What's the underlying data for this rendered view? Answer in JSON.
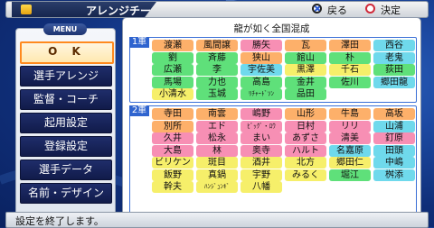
{
  "header": {
    "title": "アレンジチーム",
    "back_label": "戻る",
    "confirm_label": "決定"
  },
  "menu": {
    "heading": "MENU",
    "items": [
      {
        "label": "O K"
      },
      {
        "label": "選手アレンジ"
      },
      {
        "label": "監督・コーチ"
      },
      {
        "label": "起用設定"
      },
      {
        "label": "登録設定"
      },
      {
        "label": "選手データ"
      },
      {
        "label": "名前・デザイン"
      }
    ]
  },
  "roster": {
    "title": "龍が如く全国混成",
    "colors": {
      "orange": "#fdb06a",
      "pink": "#f78fb4",
      "green": "#5fe07a",
      "yellow": "#f6ef6a",
      "cyan": "#6fd9ec",
      "accent_blue": "#2f64cf"
    },
    "first_team": {
      "label": "1軍",
      "players": [
        [
          "渡瀬",
          "orange"
        ],
        [
          "風間譲",
          "orange"
        ],
        [
          "勝矢",
          "pink"
        ],
        [
          "瓦",
          "orange"
        ],
        [
          "澤田",
          "orange"
        ],
        [
          "西谷",
          "cyan"
        ],
        [
          "劉",
          "green"
        ],
        [
          "斉藤",
          "green"
        ],
        [
          "狭山",
          "orange"
        ],
        [
          "館山",
          "green"
        ],
        [
          "朴",
          "green"
        ],
        [
          "老鬼",
          "cyan"
        ],
        [
          "広瀬",
          "green"
        ],
        [
          "李",
          "green"
        ],
        [
          "宇佐美",
          "cyan"
        ],
        [
          "黒澤",
          "yellow"
        ],
        [
          "千石",
          "yellow"
        ],
        [
          "荻田",
          "green"
        ],
        [
          "馬場",
          "green"
        ],
        [
          "力也",
          "green"
        ],
        [
          "高島",
          "green"
        ],
        [
          "金井",
          "green"
        ],
        [
          "佐川",
          "green"
        ],
        [
          "郷田龍",
          "cyan"
        ],
        [
          "小清水",
          "yellow"
        ],
        [
          "玉城",
          "green"
        ],
        [
          "ﾘﾁｬｰﾄﾞｿﾝ",
          "green"
        ],
        [
          "品田",
          "green"
        ]
      ]
    },
    "second_team": {
      "label": "2軍",
      "players": [
        [
          "寺田",
          "orange"
        ],
        [
          "南雲",
          "orange"
        ],
        [
          "嶋野",
          "pink"
        ],
        [
          "山形",
          "orange"
        ],
        [
          "牛島",
          "orange"
        ],
        [
          "高坂",
          "orange"
        ],
        [
          "別所",
          "orange"
        ],
        [
          "エド",
          "pink"
        ],
        [
          "ﾋﾞｯｸﾞ・ﾛｳ",
          "pink"
        ],
        [
          "日村",
          "pink"
        ],
        [
          "リリ",
          "pink"
        ],
        [
          "山浦",
          "cyan"
        ],
        [
          "久井",
          "pink"
        ],
        [
          "松永",
          "pink"
        ],
        [
          "まい",
          "pink"
        ],
        [
          "あずさ",
          "pink"
        ],
        [
          "清美",
          "pink"
        ],
        [
          "釘原",
          "pink"
        ],
        [
          "大島",
          "pink"
        ],
        [
          "林",
          "pink"
        ],
        [
          "奥寺",
          "pink"
        ],
        [
          "ハルト",
          "pink"
        ],
        [
          "名嘉原",
          "cyan"
        ],
        [
          "田頭",
          "cyan"
        ],
        [
          "ビリケン",
          "yellow"
        ],
        [
          "斑目",
          "yellow"
        ],
        [
          "酒井",
          "yellow"
        ],
        [
          "北方",
          "yellow"
        ],
        [
          "郷田仁",
          "yellow"
        ],
        [
          "中嶋",
          "cyan"
        ],
        [
          "飯野",
          "yellow"
        ],
        [
          "真鍋",
          "yellow"
        ],
        [
          "宇野",
          "yellow"
        ],
        [
          "みるく",
          "yellow"
        ],
        [
          "堀江",
          "green"
        ],
        [
          "桝添",
          "cyan"
        ],
        [
          "幹夫",
          "yellow"
        ],
        [
          "ﾊﾝｼﾞｭﾝｷﾞ",
          "yellow"
        ],
        [
          "八幡",
          "yellow"
        ]
      ]
    }
  },
  "footer": {
    "message": "設定を終了します。"
  }
}
